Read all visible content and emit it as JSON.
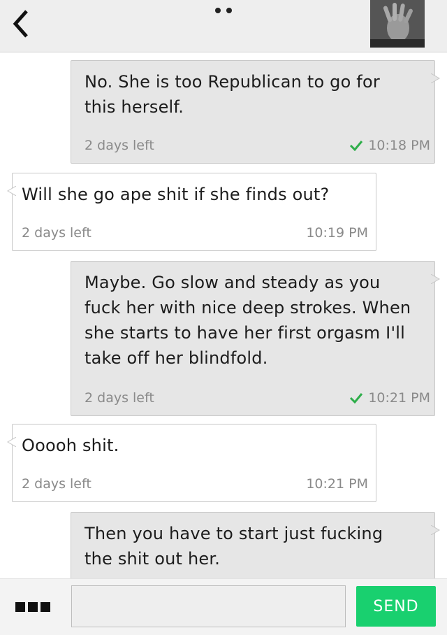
{
  "header": {
    "back_icon": "chevron-left-icon",
    "menu_icon": "two-dot-icon",
    "avatar_icon": "contact-avatar-photo"
  },
  "messages": [
    {
      "direction": "out",
      "text": "No. She is too Republican to go for this herself.",
      "expires": "2 days left",
      "time": "10:18 PM",
      "delivered": true
    },
    {
      "direction": "in",
      "text": "Will she go ape shit if she finds out?",
      "expires": "2 days left",
      "time": "10:19 PM",
      "delivered": false
    },
    {
      "direction": "out",
      "text": "Maybe. Go slow and steady as you fuck her with nice deep strokes. When she starts to have her first orgasm I'll take off her blindfold.",
      "expires": "2 days left",
      "time": "10:21 PM",
      "delivered": true
    },
    {
      "direction": "in",
      "text": "Ooooh shit.",
      "expires": "2 days left",
      "time": "10:21 PM",
      "delivered": false
    },
    {
      "direction": "out",
      "text": "Then you have to start just fucking the shit out her.",
      "expires": "",
      "time": "",
      "delivered": false
    }
  ],
  "composer": {
    "menu_icon": "three-squares-menu-icon",
    "input_value": "",
    "input_placeholder": "",
    "send_label": "SEND"
  },
  "colors": {
    "accent": "#19d06f",
    "check": "#2eae4a",
    "outgoing_bubble": "#e6e6e6",
    "incoming_bubble": "#ffffff"
  }
}
